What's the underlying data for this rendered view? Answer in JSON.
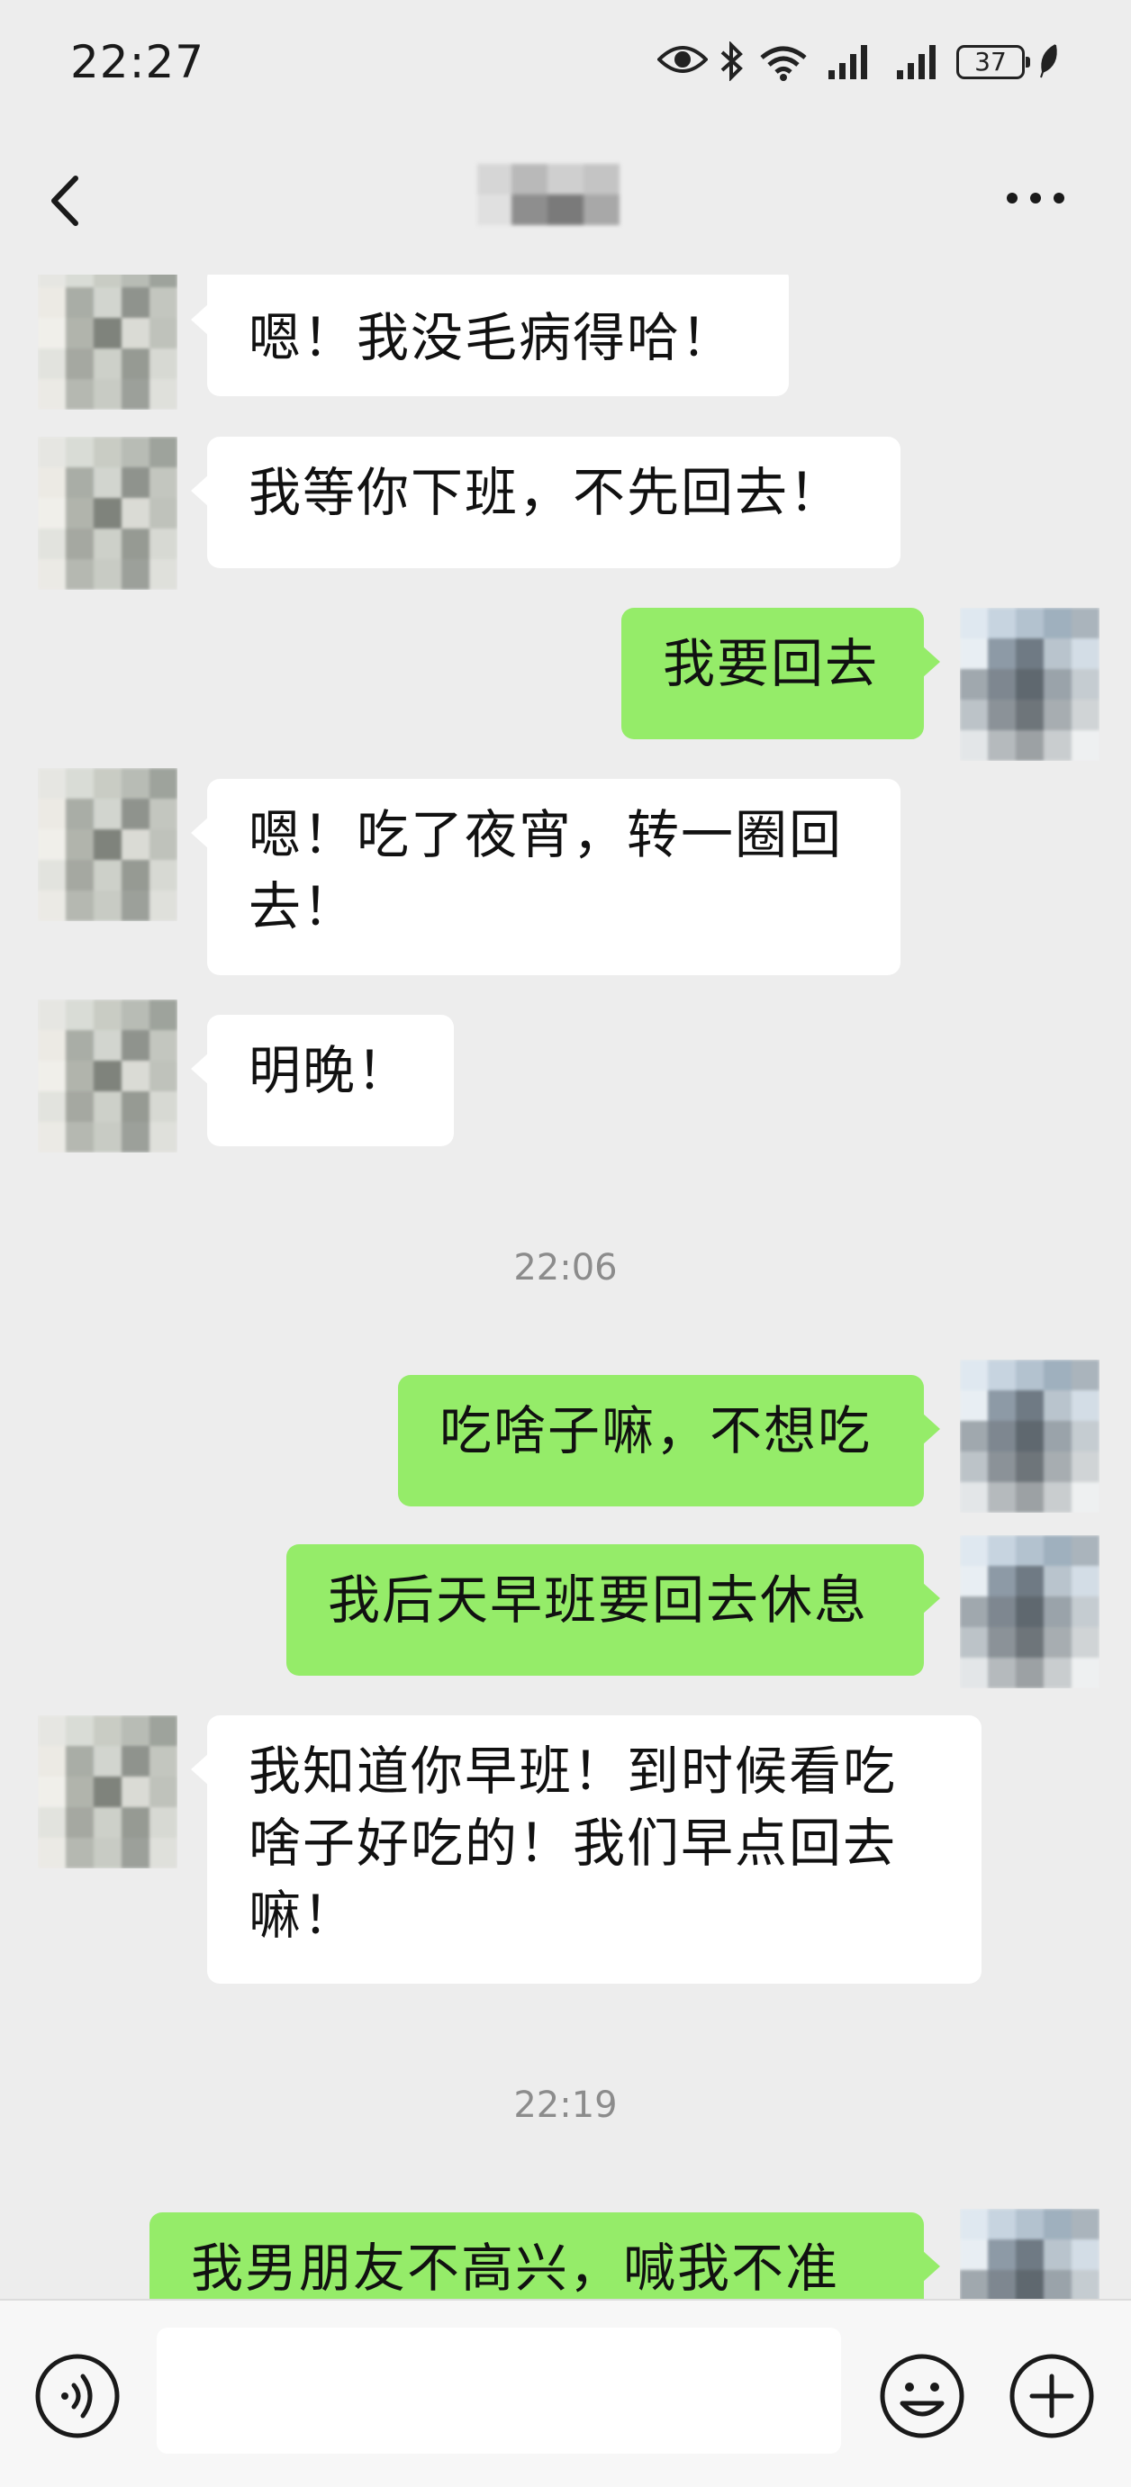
{
  "status_bar": {
    "time": "22:27",
    "battery": "37",
    "icons": [
      "eye-icon",
      "bluetooth-icon",
      "wifi-6-icon",
      "signal-icon",
      "signal-icon",
      "battery-icon",
      "leaf-icon"
    ]
  },
  "nav": {
    "back_icon": "chevron-left-icon",
    "title_blurred": true,
    "more_icon": "more-dots-icon"
  },
  "messages": [
    {
      "side": "in",
      "text": "嗯！我没毛病得哈！"
    },
    {
      "side": "in",
      "text": "我等你下班，不先回去！"
    },
    {
      "side": "out",
      "text": "我要回去"
    },
    {
      "side": "in",
      "text": "嗯！吃了夜宵，转一圈回\n去！"
    },
    {
      "side": "in",
      "text": "明晚！"
    },
    {
      "side": "out",
      "text": "吃啥子嘛，不想吃"
    },
    {
      "side": "out",
      "text": "我后天早班要回去休息"
    },
    {
      "side": "in",
      "text": "我知道你早班！到时候看吃\n啥子好吃的！我们早点回去\n嘛！"
    },
    {
      "side": "out",
      "text": "我男朋友不高兴，喊我不准"
    }
  ],
  "timestamps": [
    "22:06",
    "22:19"
  ],
  "input_bar": {
    "voice_icon": "voice-icon",
    "input_value": "",
    "emoji_icon": "emoji-icon",
    "plus_icon": "plus-icon"
  },
  "colors": {
    "background": "#ededed",
    "incoming_bubble": "#ffffff",
    "outgoing_bubble": "#95ec69",
    "timestamp_text": "#8c8c8c"
  }
}
